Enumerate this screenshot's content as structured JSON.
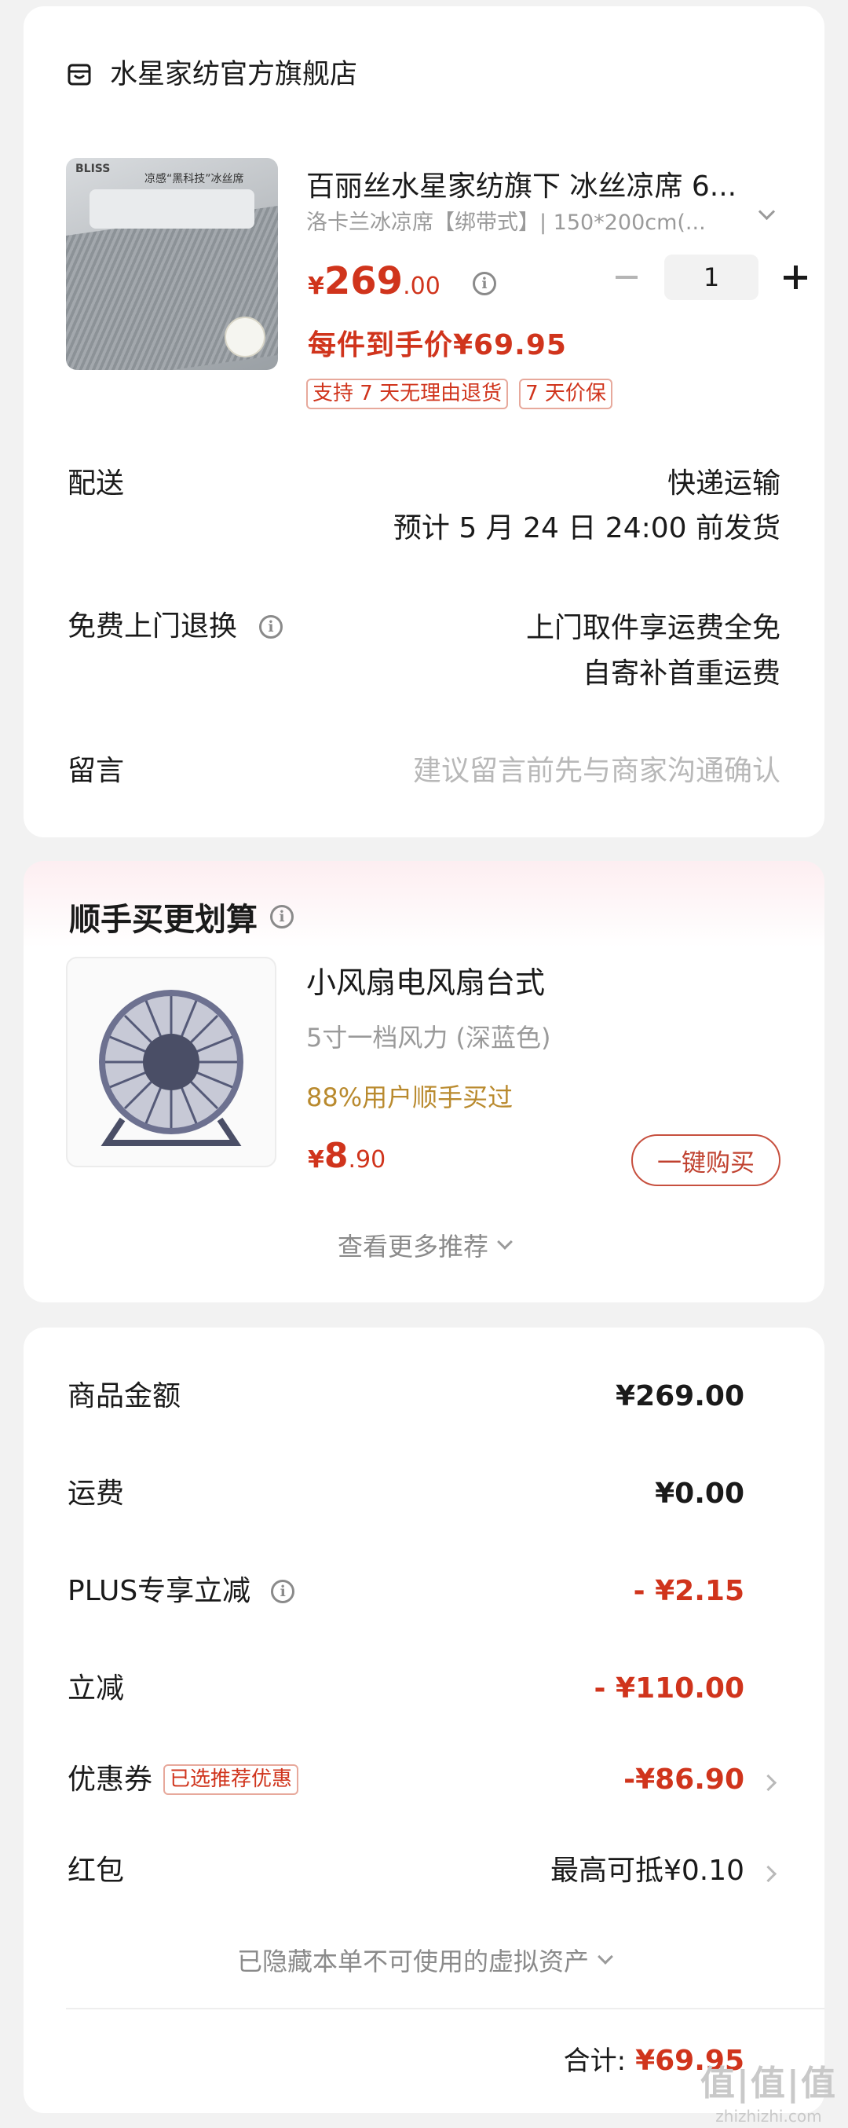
{
  "colors": {
    "accent": "#d0341c",
    "gold": "#b98a2e",
    "background": "#f2f2f2"
  },
  "store": {
    "icon": "store-icon",
    "name": "水星家纺官方旗舰店"
  },
  "product": {
    "image_brand": "BLISS",
    "image_headline": "凉感“黑科技”冰丝席",
    "title": "百丽丝水星家纺旗下  冰丝凉席 6...",
    "spec": "洛卡兰冰凉席【绑带式】| 150*200cm(...",
    "price_symbol": "¥",
    "price_int": "269",
    "price_dec": ".00",
    "unit_price": "每件到手价¥69.95",
    "quantity": "1",
    "tags": [
      "支持 7 天无理由退货",
      "7 天价保"
    ]
  },
  "delivery": {
    "label": "配送",
    "method": "快递运输",
    "estimate": "预计 5 月 24 日 24:00 前发货"
  },
  "return_service": {
    "label": "免费上门退换",
    "line1": "上门取件享运费全免",
    "line2": "自寄补首重运费"
  },
  "message": {
    "label": "留言",
    "placeholder": "建议留言前先与商家沟通确认"
  },
  "addon": {
    "title": "顺手买更划算",
    "name": "小风扇电风扇台式",
    "spec": "5寸一档风力 (深蓝色)",
    "social": "88%用户顺手买过",
    "price_symbol": "¥",
    "price_int": "8",
    "price_dec": ".90",
    "buy_button": "一键购买",
    "more": "查看更多推荐"
  },
  "summary": {
    "rows": [
      {
        "label": "商品金额",
        "value": "¥269.00"
      },
      {
        "label": "运费",
        "value": "¥0.00"
      },
      {
        "label": "PLUS专享立减",
        "value": "- ¥2.15"
      },
      {
        "label": "立减",
        "value": "- ¥110.00"
      },
      {
        "label": "优惠券",
        "tag": "已选推荐优惠",
        "value": "-¥86.90"
      },
      {
        "label": "红包",
        "value": "最高可抵¥0.10"
      }
    ],
    "hidden_assets": "已隐藏本单不可使用的虚拟资产",
    "total_label": "合计:",
    "total_value": "¥69.95"
  },
  "watermark": {
    "logo": "值|值|值",
    "url": "zhizhizhi.com"
  }
}
